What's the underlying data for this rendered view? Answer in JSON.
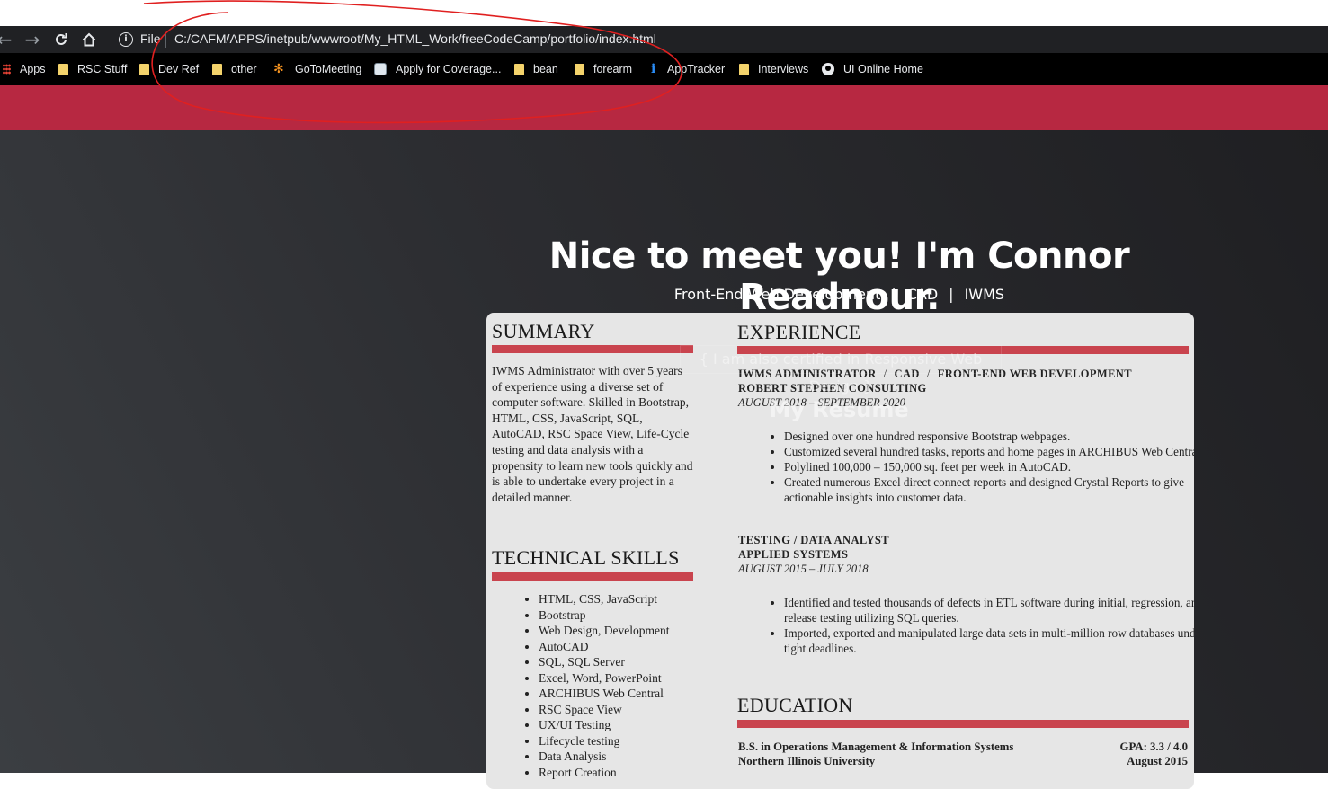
{
  "browser": {
    "nav": {
      "back_icon": "←",
      "forward_icon": "→",
      "reload_icon": "⟳",
      "home_icon": "⌂"
    },
    "address_bar": {
      "scheme": "File",
      "url": "C:/CAFM/APPS/inetpub/wwwroot/My_HTML_Work/freeCodeCamp/portfolio/index.html"
    },
    "bookmarks": [
      {
        "label": "Apps",
        "icon": "apps-grid-icon"
      },
      {
        "label": "RSC Stuff",
        "icon": "folder-icon"
      },
      {
        "label": "Dev Ref",
        "icon": "folder-icon"
      },
      {
        "label": "other",
        "icon": "folder-icon"
      },
      {
        "label": "GoToMeeting",
        "icon": "gotomeeting-icon"
      },
      {
        "label": "Apply for Coverage...",
        "icon": "coverage-icon"
      },
      {
        "label": "bean",
        "icon": "folder-icon"
      },
      {
        "label": "forearm",
        "icon": "folder-icon"
      },
      {
        "label": "AppTracker",
        "icon": "apptracker-icon"
      },
      {
        "label": "Interviews",
        "icon": "folder-icon"
      },
      {
        "label": "UI Online Home",
        "icon": "globe-icon"
      }
    ]
  },
  "colors": {
    "accent": "#b72841",
    "rule": "#c9444e",
    "background": "#2c2d31",
    "annotation": "#e02020"
  },
  "hero": {
    "headline": "Nice to meet you! I'm Connor Readnour.",
    "tags": [
      "Front-End Web Development",
      "CAD",
      "IWMS"
    ]
  },
  "overlays": {
    "certified": "{ I am also certified in Responsive Web Design }",
    "resume_label": "My Resume"
  },
  "resume": {
    "summary": {
      "title": "SUMMARY",
      "text": "IWMS Administrator with over 5 years of experience using a diverse set of computer software. Skilled in Bootstrap, HTML, CSS, JavaScript, SQL, AutoCAD, RSC Space View, Life-Cycle testing and data analysis with a propensity to learn new tools quickly and is able to undertake every project in a detailed manner."
    },
    "skills": {
      "title": "TECHNICAL SKILLS",
      "items": [
        "HTML, CSS, JavaScript",
        "Bootstrap",
        "Web Design, Development",
        "AutoCAD",
        "SQL, SQL Server",
        "Excel, Word, PowerPoint",
        "ARCHIBUS Web Central",
        "RSC Space View",
        "UX/UI Testing",
        "Lifecycle testing",
        "Data Analysis",
        "Report Creation"
      ]
    },
    "experience": {
      "title": "EXPERIENCE",
      "jobs": [
        {
          "roles": [
            "IWMS ADMINISTRATOR",
            "CAD",
            "FRONT-END WEB DEVELOPMENT"
          ],
          "company": "ROBERT STEPHEN CONSULTING",
          "dates": "AUGUST 2018 – SEPTEMBER 2020",
          "duties": [
            "Designed over one hundred responsive Bootstrap webpages.",
            "Customized several hundred tasks, reports and home pages in ARCHIBUS Web Central.",
            "Polylined 100,000 – 150,000 sq. feet per week in AutoCAD.",
            "Created numerous Excel direct connect reports and designed Crystal Reports to give actionable insights into customer data."
          ]
        },
        {
          "roles": [
            "TESTING / DATA ANALYST"
          ],
          "company": "APPLIED SYSTEMS",
          "dates": "AUGUST 2015 – JULY 2018",
          "duties": [
            "Identified and tested thousands of defects in ETL software during initial, regression, and release testing utilizing SQL queries.",
            "Imported, exported and manipulated large data sets in multi-million row databases under tight deadlines."
          ]
        }
      ]
    },
    "education": {
      "title": "EDUCATION",
      "degree": "B.S. in Operations Management & Information Systems",
      "gpa": "GPA: 3.3 / 4.0",
      "school": "Northern Illinois University",
      "date": "August 2015"
    }
  }
}
